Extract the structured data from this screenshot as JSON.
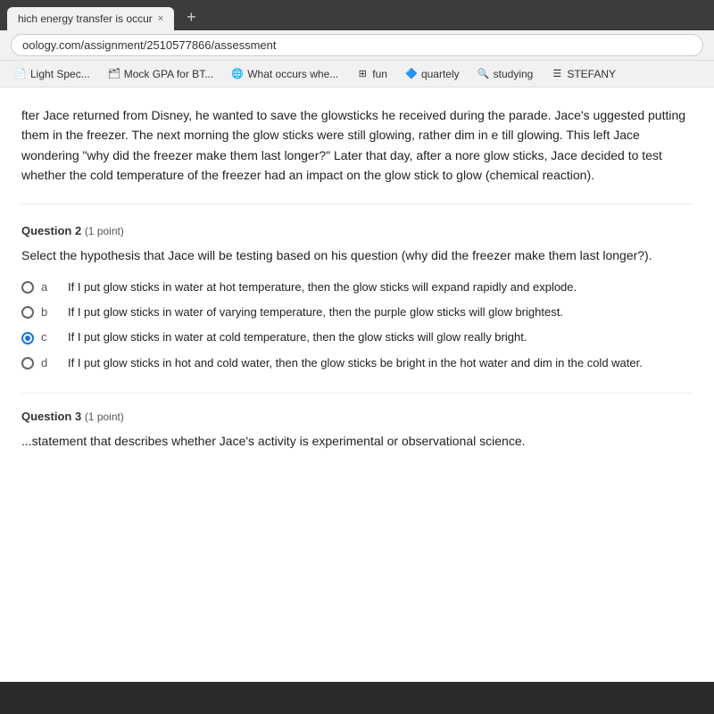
{
  "browser": {
    "tab_title": "hich energy transfer is occur",
    "tab_close": "×",
    "tab_new": "+",
    "address": "oology.com/assignment/2510577866/assessment"
  },
  "bookmarks": [
    {
      "id": "bm1",
      "label": "Light Spec...",
      "icon": "📄"
    },
    {
      "id": "bm2",
      "label": "Mock GPA for BT...",
      "icon": "🗂"
    },
    {
      "id": "bm3",
      "label": "What occurs whe...",
      "icon": "🌐"
    },
    {
      "id": "bm4",
      "label": "fun",
      "icon": "⊞"
    },
    {
      "id": "bm5",
      "label": "quartely",
      "icon": "🔷"
    },
    {
      "id": "bm6",
      "label": "studying",
      "icon": "🔍"
    },
    {
      "id": "bm7",
      "label": "STEFANY",
      "icon": "☰"
    }
  ],
  "passage": {
    "text": "fter Jace returned from Disney, he wanted to save the glowsticks he received during the parade. Jace's uggested putting them in the freezer. The next morning the glow sticks were still glowing, rather dim in e till glowing. This left Jace wondering \"why did the freezer make them last longer?\" Later that day, after a nore glow sticks, Jace decided to test whether the cold temperature of the freezer had an impact on the glow stick to glow (chemical reaction)."
  },
  "question2": {
    "label": "Question 2",
    "points": "(1 point)",
    "text": "Select the hypothesis that Jace will be testing based on his question (why did the freezer make them last longer?).",
    "options": [
      {
        "letter": "a",
        "text": "If I put glow sticks in water at hot temperature, then the glow sticks will expand rapidly and explode.",
        "selected": false
      },
      {
        "letter": "b",
        "text": "If I put glow sticks in water of varying temperature, then the purple glow sticks will glow brightest.",
        "selected": false
      },
      {
        "letter": "c",
        "text": "If I put glow sticks in water at cold temperature, then the glow sticks will glow really bright.",
        "selected": true
      },
      {
        "letter": "d",
        "text": "If I put glow sticks in hot and cold water, then the glow sticks be bright in the hot water and dim in the cold water.",
        "selected": false
      }
    ]
  },
  "question3": {
    "label": "Question 3",
    "points": "(1 point)",
    "text": "...statement that describes whether Jace's activity is experimental or observational science."
  }
}
